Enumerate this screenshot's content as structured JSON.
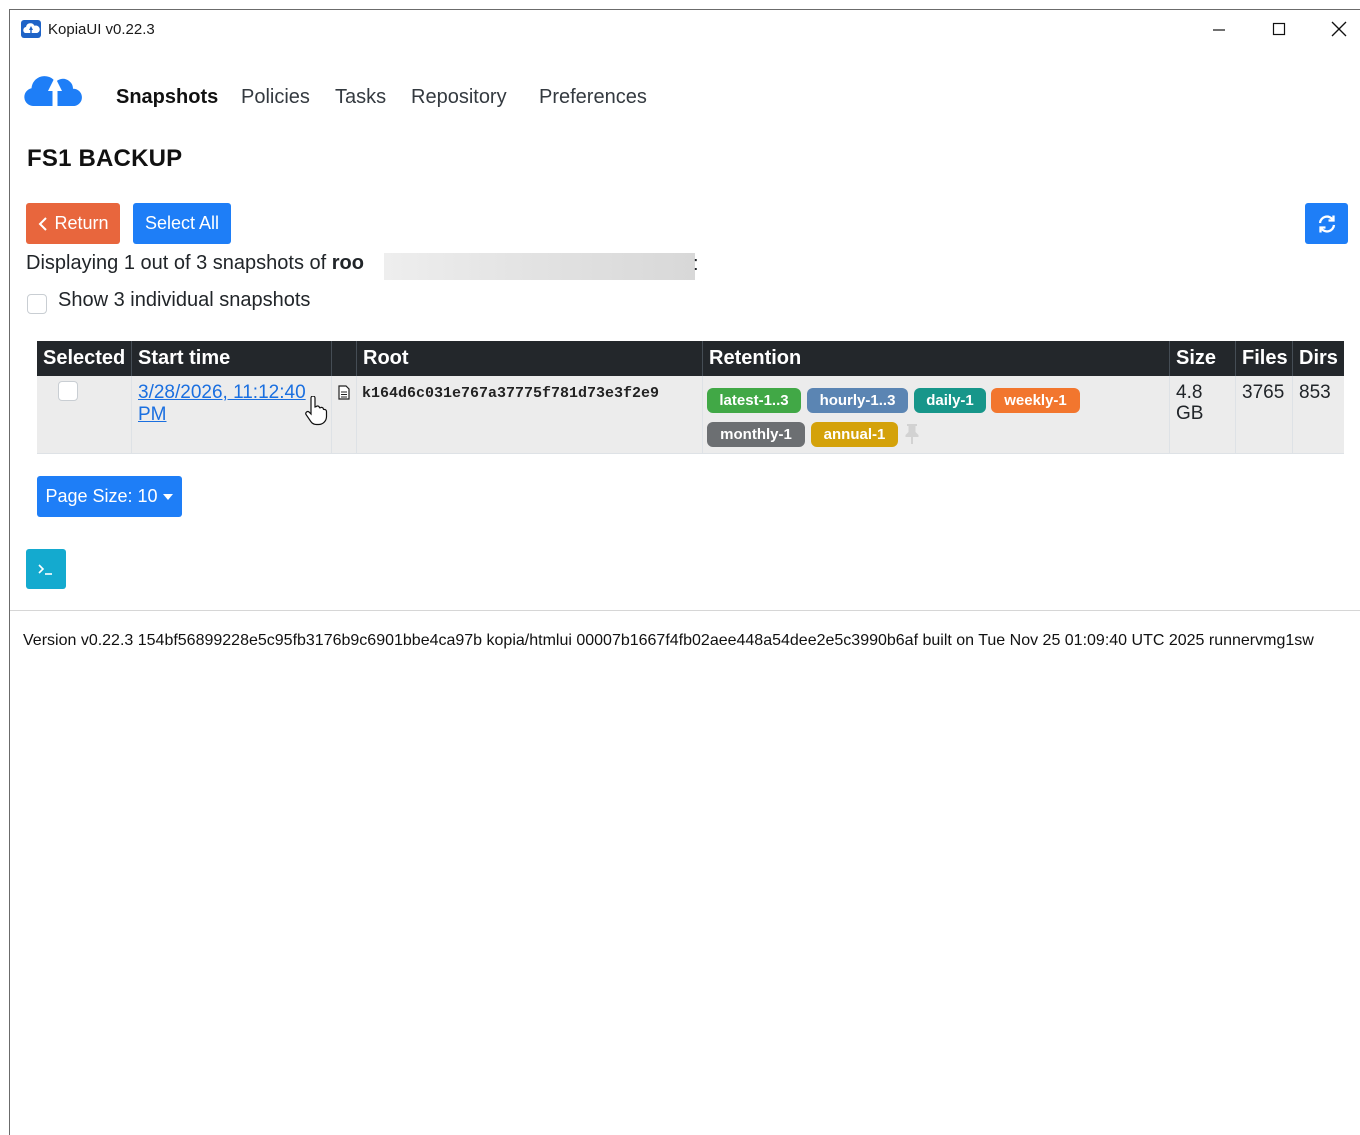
{
  "window": {
    "title": "KopiaUI v0.22.3"
  },
  "nav": {
    "items": [
      {
        "label": "Snapshots",
        "active": true
      },
      {
        "label": "Policies",
        "active": false
      },
      {
        "label": "Tasks",
        "active": false
      },
      {
        "label": "Repository",
        "active": false
      },
      {
        "label": "Preferences",
        "active": false
      }
    ]
  },
  "page": {
    "title": "FS1 BACKUP",
    "return_label": "Return",
    "select_all_label": "Select All",
    "displaying_prefix": "Displaying 1 out of 3 snapshots of ",
    "displaying_root": "roo",
    "displaying_suffix": ":",
    "show_individual_label": "Show 3 individual snapshots",
    "show_individual_checked": false
  },
  "table": {
    "headers": [
      "Selected",
      "Start time",
      "",
      "Root",
      "Retention",
      "Size",
      "Files",
      "Dirs"
    ],
    "rows": [
      {
        "selected": false,
        "start_time_line1": "3/28/2026, 11:12:40",
        "start_time_line2": "PM",
        "root": "k164d6c031e767a37775f781d73e3f2e9",
        "retention": [
          {
            "label": "latest-1..3",
            "color": "#41a846"
          },
          {
            "label": "hourly-1..3",
            "color": "#5b85b3"
          },
          {
            "label": "daily-1",
            "color": "#17968a"
          },
          {
            "label": "weekly-1",
            "color": "#f2762e"
          },
          {
            "label": "monthly-1",
            "color": "#6c6f72"
          },
          {
            "label": "annual-1",
            "color": "#d4a20a"
          }
        ],
        "size_line1": "4.8",
        "size_line2": "GB",
        "files": "3765",
        "dirs": "853"
      }
    ]
  },
  "footer": {
    "page_size_label": "Page Size: 10",
    "version_text": "Version v0.22.3 154bf56899228e5c95fb3176b9c6901bbe4ca97b kopia/htmlui 00007b1667f4fb02aee448a54dee2e5c3990b6af built on Tue Nov 25 01:09:40 UTC 2025 runnervmg1sw"
  },
  "colors": {
    "return_button": "#e8663d",
    "primary_button": "#1e7ef7",
    "terminal_button": "#14aacf",
    "table_header": "#23272b",
    "link": "#1a6fe0"
  }
}
